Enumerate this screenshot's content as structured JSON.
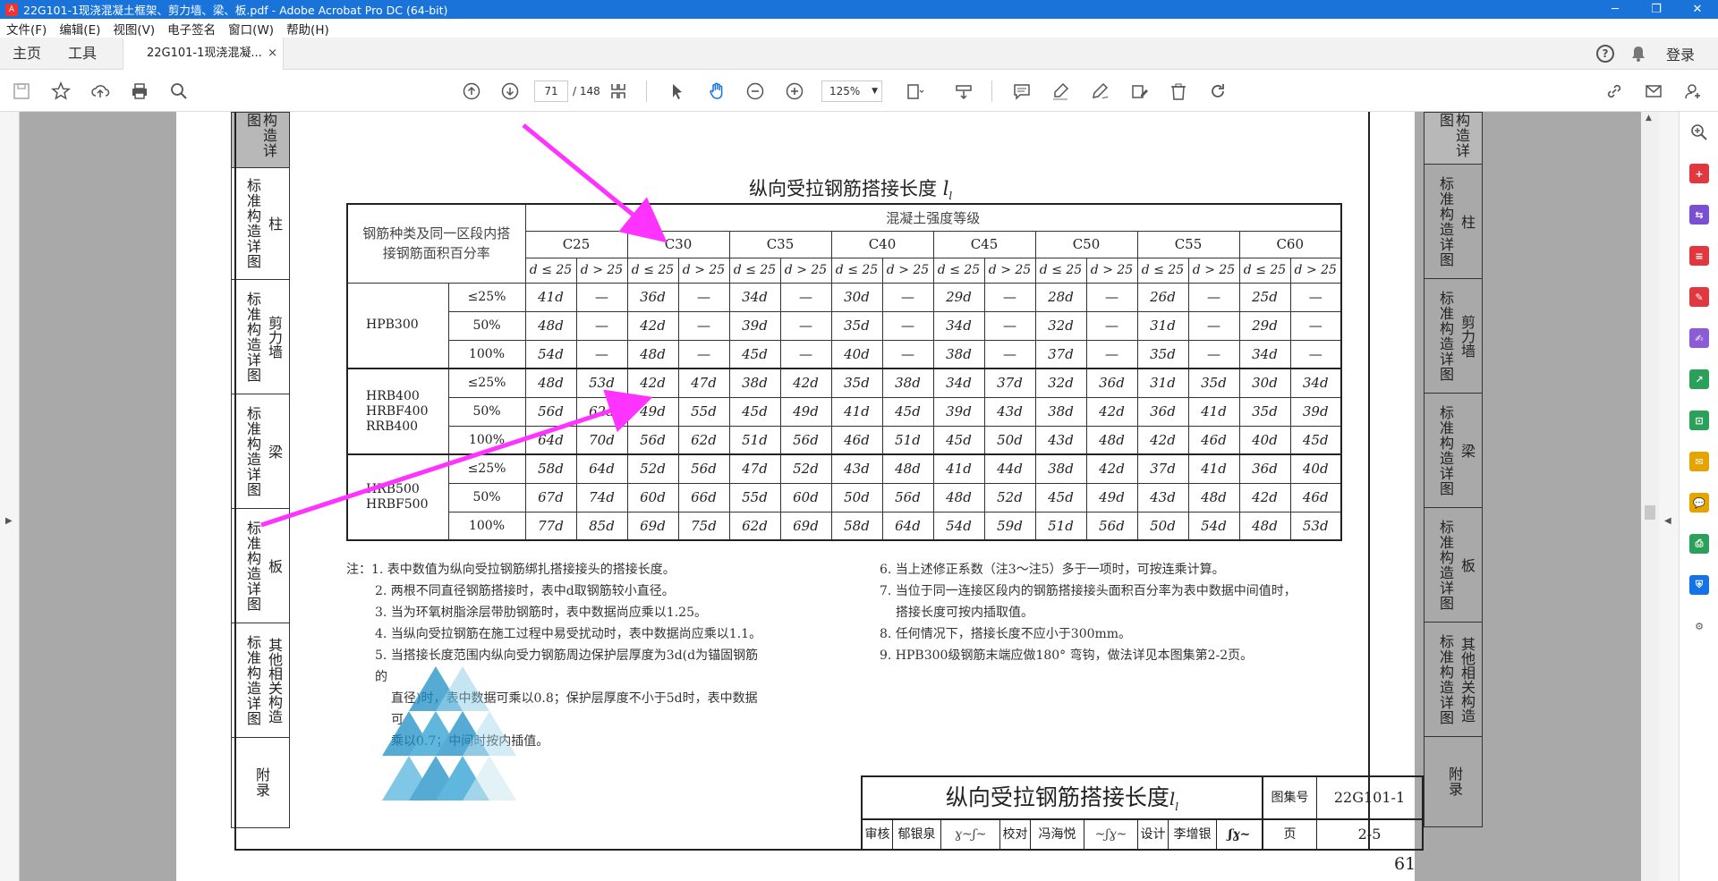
{
  "window": {
    "title": "22G101-1现浇混凝土框架、剪力墙、梁、板.pdf - Adobe Acrobat Pro DC (64-bit)"
  },
  "menu": [
    "文件(F)",
    "编辑(E)",
    "视图(V)",
    "电子签名",
    "窗口(W)",
    "帮助(H)"
  ],
  "tabs": {
    "home": "主页",
    "tools": "工具",
    "doc": "22G101-1现浇混凝...",
    "close": "×",
    "login": "登录"
  },
  "toolbar": {
    "page_current": "71",
    "page_total": "/ 148",
    "zoom": "125%"
  },
  "doc": {
    "title_main": "纵向受拉钢筋搭接长度",
    "title_sym": "l",
    "title_sub": "l",
    "header_left": "钢筋种类及同一区段内搭接钢筋面积百分率",
    "header_grade": "混凝土强度等级",
    "grades": [
      "C25",
      "C30",
      "C35",
      "C40",
      "C45",
      "C50",
      "C55",
      "C60"
    ],
    "sub_le": "d ≤ 25",
    "sub_gt": "d > 25",
    "groups": [
      {
        "name": "HPB300",
        "rows": [
          {
            "pct": "≤25%",
            "cells": [
              "41d",
              "—",
              "36d",
              "—",
              "34d",
              "—",
              "30d",
              "—",
              "29d",
              "—",
              "28d",
              "—",
              "26d",
              "—",
              "25d",
              "—"
            ]
          },
          {
            "pct": "50%",
            "cells": [
              "48d",
              "—",
              "42d",
              "—",
              "39d",
              "—",
              "35d",
              "—",
              "34d",
              "—",
              "32d",
              "—",
              "31d",
              "—",
              "29d",
              "—"
            ]
          },
          {
            "pct": "100%",
            "cells": [
              "54d",
              "—",
              "48d",
              "—",
              "45d",
              "—",
              "40d",
              "—",
              "38d",
              "—",
              "37d",
              "—",
              "35d",
              "—",
              "34d",
              "—"
            ]
          }
        ]
      },
      {
        "name": "HRB400\nHRBF400\nRRB400",
        "rows": [
          {
            "pct": "≤25%",
            "cells": [
              "48d",
              "53d",
              "42d",
              "47d",
              "38d",
              "42d",
              "35d",
              "38d",
              "34d",
              "37d",
              "32d",
              "36d",
              "31d",
              "35d",
              "30d",
              "34d"
            ]
          },
          {
            "pct": "50%",
            "cells": [
              "56d",
              "62d",
              "49d",
              "55d",
              "45d",
              "49d",
              "41d",
              "45d",
              "39d",
              "43d",
              "38d",
              "42d",
              "36d",
              "41d",
              "35d",
              "39d"
            ]
          },
          {
            "pct": "100%",
            "cells": [
              "64d",
              "70d",
              "56d",
              "62d",
              "51d",
              "56d",
              "46d",
              "51d",
              "45d",
              "50d",
              "43d",
              "48d",
              "42d",
              "46d",
              "40d",
              "45d"
            ]
          }
        ]
      },
      {
        "name": "HRB500\nHRBF500",
        "rows": [
          {
            "pct": "≤25%",
            "cells": [
              "58d",
              "64d",
              "52d",
              "56d",
              "47d",
              "52d",
              "43d",
              "48d",
              "41d",
              "44d",
              "38d",
              "42d",
              "37d",
              "41d",
              "36d",
              "40d"
            ]
          },
          {
            "pct": "50%",
            "cells": [
              "67d",
              "74d",
              "60d",
              "66d",
              "55d",
              "60d",
              "50d",
              "56d",
              "48d",
              "52d",
              "45d",
              "49d",
              "43d",
              "48d",
              "42d",
              "46d"
            ]
          },
          {
            "pct": "100%",
            "cells": [
              "77d",
              "85d",
              "69d",
              "75d",
              "62d",
              "69d",
              "58d",
              "64d",
              "54d",
              "59d",
              "51d",
              "56d",
              "50d",
              "54d",
              "48d",
              "53d"
            ]
          }
        ]
      }
    ],
    "notes_left": [
      "注：1. 表中数值为纵向受拉钢筋绑扎搭接接头的搭接长度。",
      "2. 两根不同直径钢筋搭接时，表中d取钢筋较小直径。",
      "3. 当为环氧树脂涂层带肋钢筋时，表中数据尚应乘以1.25。",
      "4. 当纵向受拉钢筋在施工过程中易受扰动时，表中数据尚应乘以1.1。",
      "5. 当搭接长度范围内纵向受力钢筋周边保护层厚度为3d(d为锚固钢筋的",
      "直径)时，表中数据可乘以0.8；保护层厚度不小于5d时，表中数据可",
      "乘以0.7；中间时按内插值。"
    ],
    "notes_right": [
      "6. 当上述修正系数（注3～注5）多于一项时，可按连乘计算。",
      "7. 当位于同一连接区段内的钢筋搭接接头面积百分率为表中数据中间值时，",
      "搭接长度可按内插取值。",
      "8. 任何情况下，搭接长度不应小于300mm。",
      "9. HPB300级钢筋末端应做180° 弯钩，做法详见本图集第2-2页。"
    ],
    "titleblock": {
      "title": "纵向受拉钢筋搭接长度",
      "atlas_label": "图集号",
      "atlas_no": "22G101-1",
      "page_label": "页",
      "page_no": "2-5",
      "audit": "审核",
      "auditor": "郁银泉",
      "check": "校对",
      "checker": "冯海悦",
      "design": "设计",
      "designer": "李增银"
    },
    "page_number": "61",
    "left_tabs": [
      "构造详图",
      "标准构造详图",
      "柱",
      "标准构造详图",
      "剪力墙",
      "标准构造详图",
      "梁",
      "标准构造详图",
      "板",
      "标准构造详图",
      "其他相关构造",
      "附录"
    ],
    "right_tabs": [
      "构造详图",
      "标准构造详图",
      "柱",
      "标准构造详图",
      "剪力墙",
      "标准构造详图",
      "梁",
      "标准构造详图",
      "板",
      "标准构造详图",
      "其他相关构造",
      "附录"
    ]
  },
  "colors": {
    "titlebar": "#1a73d9",
    "annotation": "#ff33ff",
    "accent": "#1473e6"
  }
}
